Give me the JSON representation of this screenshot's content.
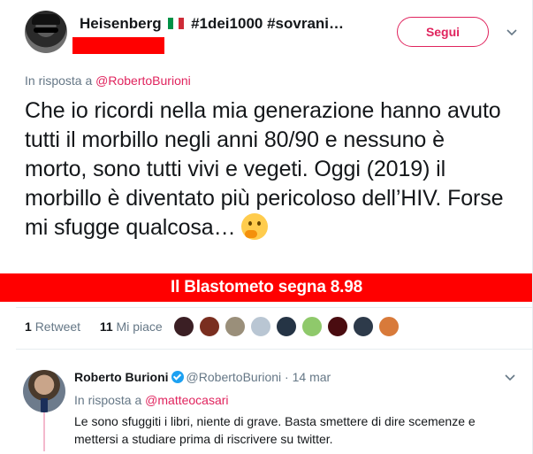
{
  "tweet": {
    "author": {
      "name": "Heisenberg",
      "flag_colors": [
        "#009246",
        "#ffffff",
        "#ce2b37"
      ],
      "tags": "#1dei1000 #sovrani…"
    },
    "follow_label": "Segui",
    "reply_prefix": "In risposta a",
    "reply_mention": "@RobertoBurioni",
    "text": "Che io ricordi nella mia generazione hanno avuto tutti il morbillo negli anni 80/90 e nessuno è morto, sono tutti vivi e vegeti. Oggi (2019) il morbillo è diventato più pericoloso dell’HIV. Forse mi sfugge qualcosa…",
    "emoji": "thinking-face",
    "stats": {
      "retweets_count": "1",
      "retweets_label": "Retweet",
      "likes_count": "11",
      "likes_label": "Mi piace"
    },
    "likers": [
      "#3b1f24",
      "#7a2e1f",
      "#9a8f7a",
      "#b9c6d3",
      "#253445",
      "#8fc96b",
      "#4a0c10",
      "#2d3a4a",
      "#d87a3a"
    ]
  },
  "banner": {
    "text": "Il Blastometo segna 8.98",
    "color": "#ff0000"
  },
  "reply": {
    "author_name": "Roberto Burioni",
    "handle": "@RobertoBurioni",
    "separator": "·",
    "date": "14 mar",
    "reply_prefix": "In risposta a",
    "reply_mention": "@matteocasari",
    "text": "Le sono sfuggiti i libri, niente di grave. Basta smettere di dire scemenze e mettersi a studiare prima di riscrivere su twitter."
  },
  "colors": {
    "accent": "#e0245e",
    "muted": "#657786",
    "verified": "#1da1f2"
  }
}
